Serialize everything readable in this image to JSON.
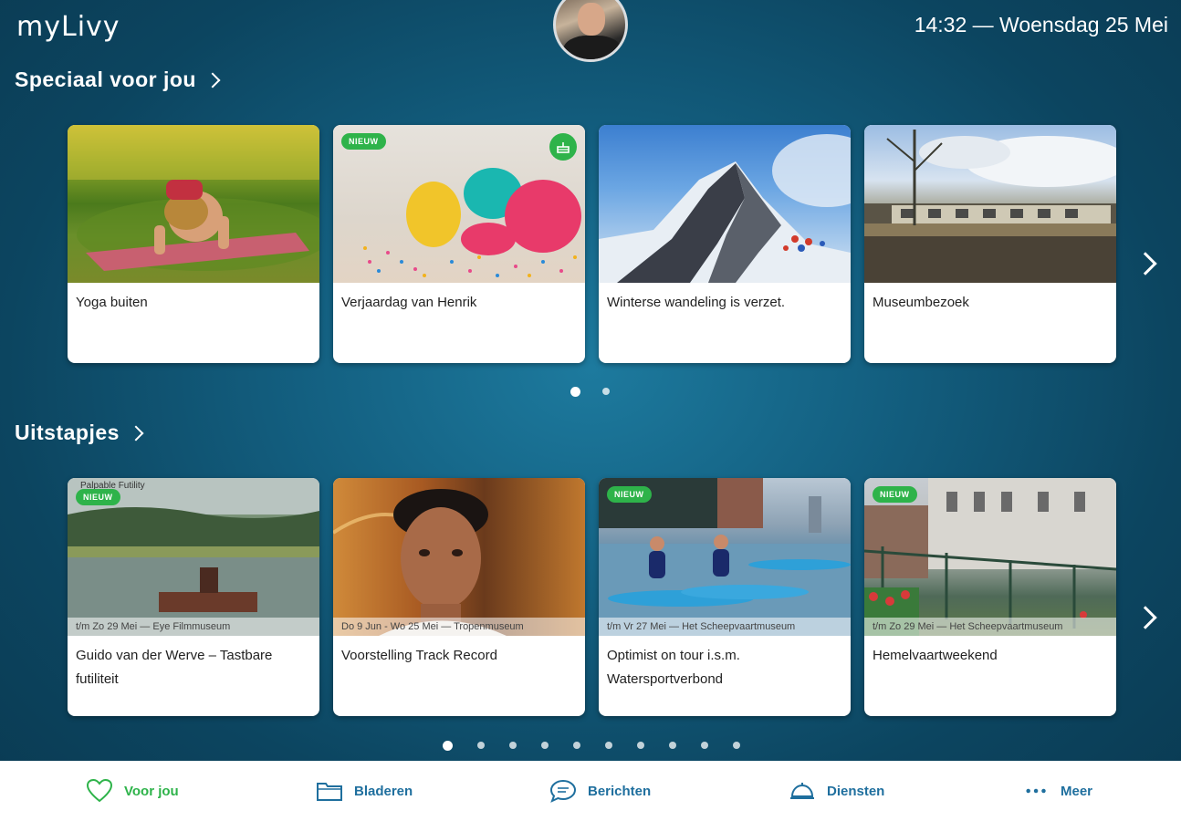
{
  "header": {
    "logo": "myLivy",
    "clock": "14:32 — Woensdag 25 Mei"
  },
  "sections": [
    {
      "title": "Speciaal voor jou",
      "cards": [
        {
          "title": "Yoga buiten",
          "image": "yoga-photo"
        },
        {
          "title": "Verjaardag van Henrik",
          "badge": "NIEUW",
          "icon": "cake-icon",
          "image": "balloons-photo"
        },
        {
          "title": "Winterse wandeling is verzet.",
          "image": "mountain-photo"
        },
        {
          "title": "Museumbezoek",
          "image": "museum-building-photo"
        }
      ],
      "pagination": {
        "total": 2,
        "active": 0
      }
    },
    {
      "title": "Uitstapjes",
      "cards": [
        {
          "title": "Guido van der Werve – Tastbare futiliteit",
          "badge": "NIEUW",
          "meta": "t/m Zo 29 Mei — Eye Filmmuseum",
          "watermark": "Palpable Futility",
          "image": "lake-photo"
        },
        {
          "title": "Voorstelling Track Record",
          "meta": "Do 9 Jun - Wo 25 Mei — Tropenmuseum",
          "image": "portrait-photo"
        },
        {
          "title": "Optimist on tour i.s.m. Watersportverbond",
          "badge": "NIEUW",
          "meta": "t/m Vr 27 Mei — Het Scheepvaartmuseum",
          "image": "paddleboard-photo"
        },
        {
          "title": "Hemelvaartweekend",
          "badge": "NIEUW",
          "meta": "t/m Zo 29 Mei — Het Scheepvaartmuseum",
          "image": "canal-photo"
        }
      ],
      "pagination": {
        "total": 10,
        "active": 0
      }
    }
  ],
  "bottom_nav": [
    {
      "label": "Voor jou",
      "icon": "heart-icon",
      "color": "#2eb34a",
      "active": true
    },
    {
      "label": "Bladeren",
      "icon": "folder-icon",
      "color": "#1f6f9e"
    },
    {
      "label": "Berichten",
      "icon": "chat-icon",
      "color": "#1f6f9e"
    },
    {
      "label": "Diensten",
      "icon": "service-bell-icon",
      "color": "#1f6f9e"
    },
    {
      "label": "Meer",
      "icon": "more-dots-icon",
      "color": "#1f6f9e"
    }
  ]
}
